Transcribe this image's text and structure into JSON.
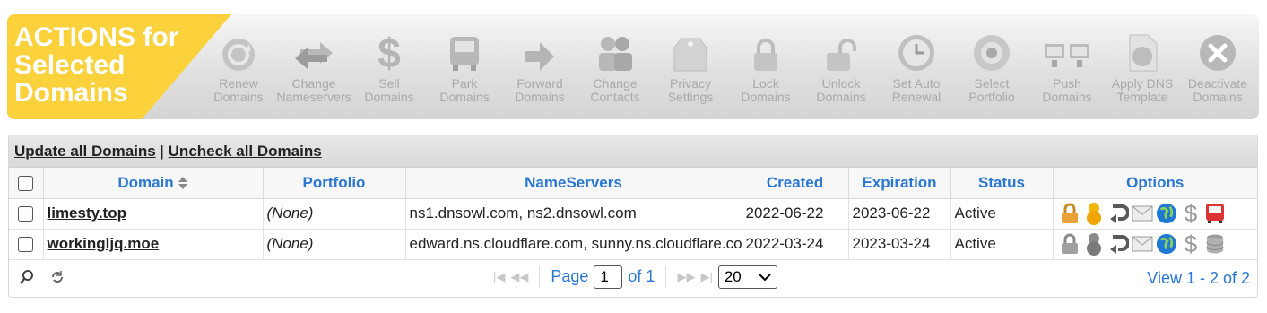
{
  "actions_title": [
    "ACTIONS for",
    "Selected",
    "Domains"
  ],
  "actions": [
    {
      "label": [
        "Renew",
        "Domains"
      ],
      "icon": "refresh-icon"
    },
    {
      "label": [
        "Change",
        "Nameservers"
      ],
      "icon": "swap-arrows-icon"
    },
    {
      "label": [
        "Sell",
        "Domains"
      ],
      "icon": "dollar-icon"
    },
    {
      "label": [
        "Park",
        "Domains"
      ],
      "icon": "bus-icon"
    },
    {
      "label": [
        "Forward",
        "Domains"
      ],
      "icon": "arrow-right-icon"
    },
    {
      "label": [
        "Change",
        "Contacts"
      ],
      "icon": "contacts-icon"
    },
    {
      "label": [
        "Privacy",
        "Settings"
      ],
      "icon": "privacy-tag-icon"
    },
    {
      "label": [
        "Lock",
        "Domains"
      ],
      "icon": "lock-icon"
    },
    {
      "label": [
        "Unlock",
        "Domains"
      ],
      "icon": "unlock-icon"
    },
    {
      "label": [
        "Set Auto",
        "Renewal"
      ],
      "icon": "clock-icon"
    },
    {
      "label": [
        "Select",
        "Portfolio"
      ],
      "icon": "portfolio-icon"
    },
    {
      "label": [
        "Push",
        "Domains"
      ],
      "icon": "monitors-icon"
    },
    {
      "label": [
        "Apply DNS",
        "Template"
      ],
      "icon": "dns-template-icon"
    },
    {
      "label": [
        "Deactivate",
        "Domains"
      ],
      "icon": "close-circle-icon"
    }
  ],
  "grid": {
    "update_all": "Update all Domains",
    "separator": "|",
    "uncheck_all": "Uncheck all Domains",
    "columns": [
      "Domain",
      "Portfolio",
      "NameServers",
      "Created",
      "Expiration",
      "Status",
      "Options"
    ],
    "rows": [
      {
        "domain": "limesty.top",
        "portfolio": "(None)",
        "nameservers": "ns1.dnsowl.com, ns2.dnsowl.com",
        "created": "2022-06-22",
        "expiration": "2023-06-22",
        "status": "Active"
      },
      {
        "domain": "workingljq.moe",
        "portfolio": "(None)",
        "nameservers": "edward.ns.cloudflare.com, sunny.ns.cloudflare.com",
        "created": "2022-03-24",
        "expiration": "2023-03-24",
        "status": "Active"
      }
    ]
  },
  "pager": {
    "page_label": "Page",
    "page_value": "1",
    "of_label": "of 1",
    "rows_per_page": "20",
    "view_text": "View 1 - 2 of 2"
  }
}
